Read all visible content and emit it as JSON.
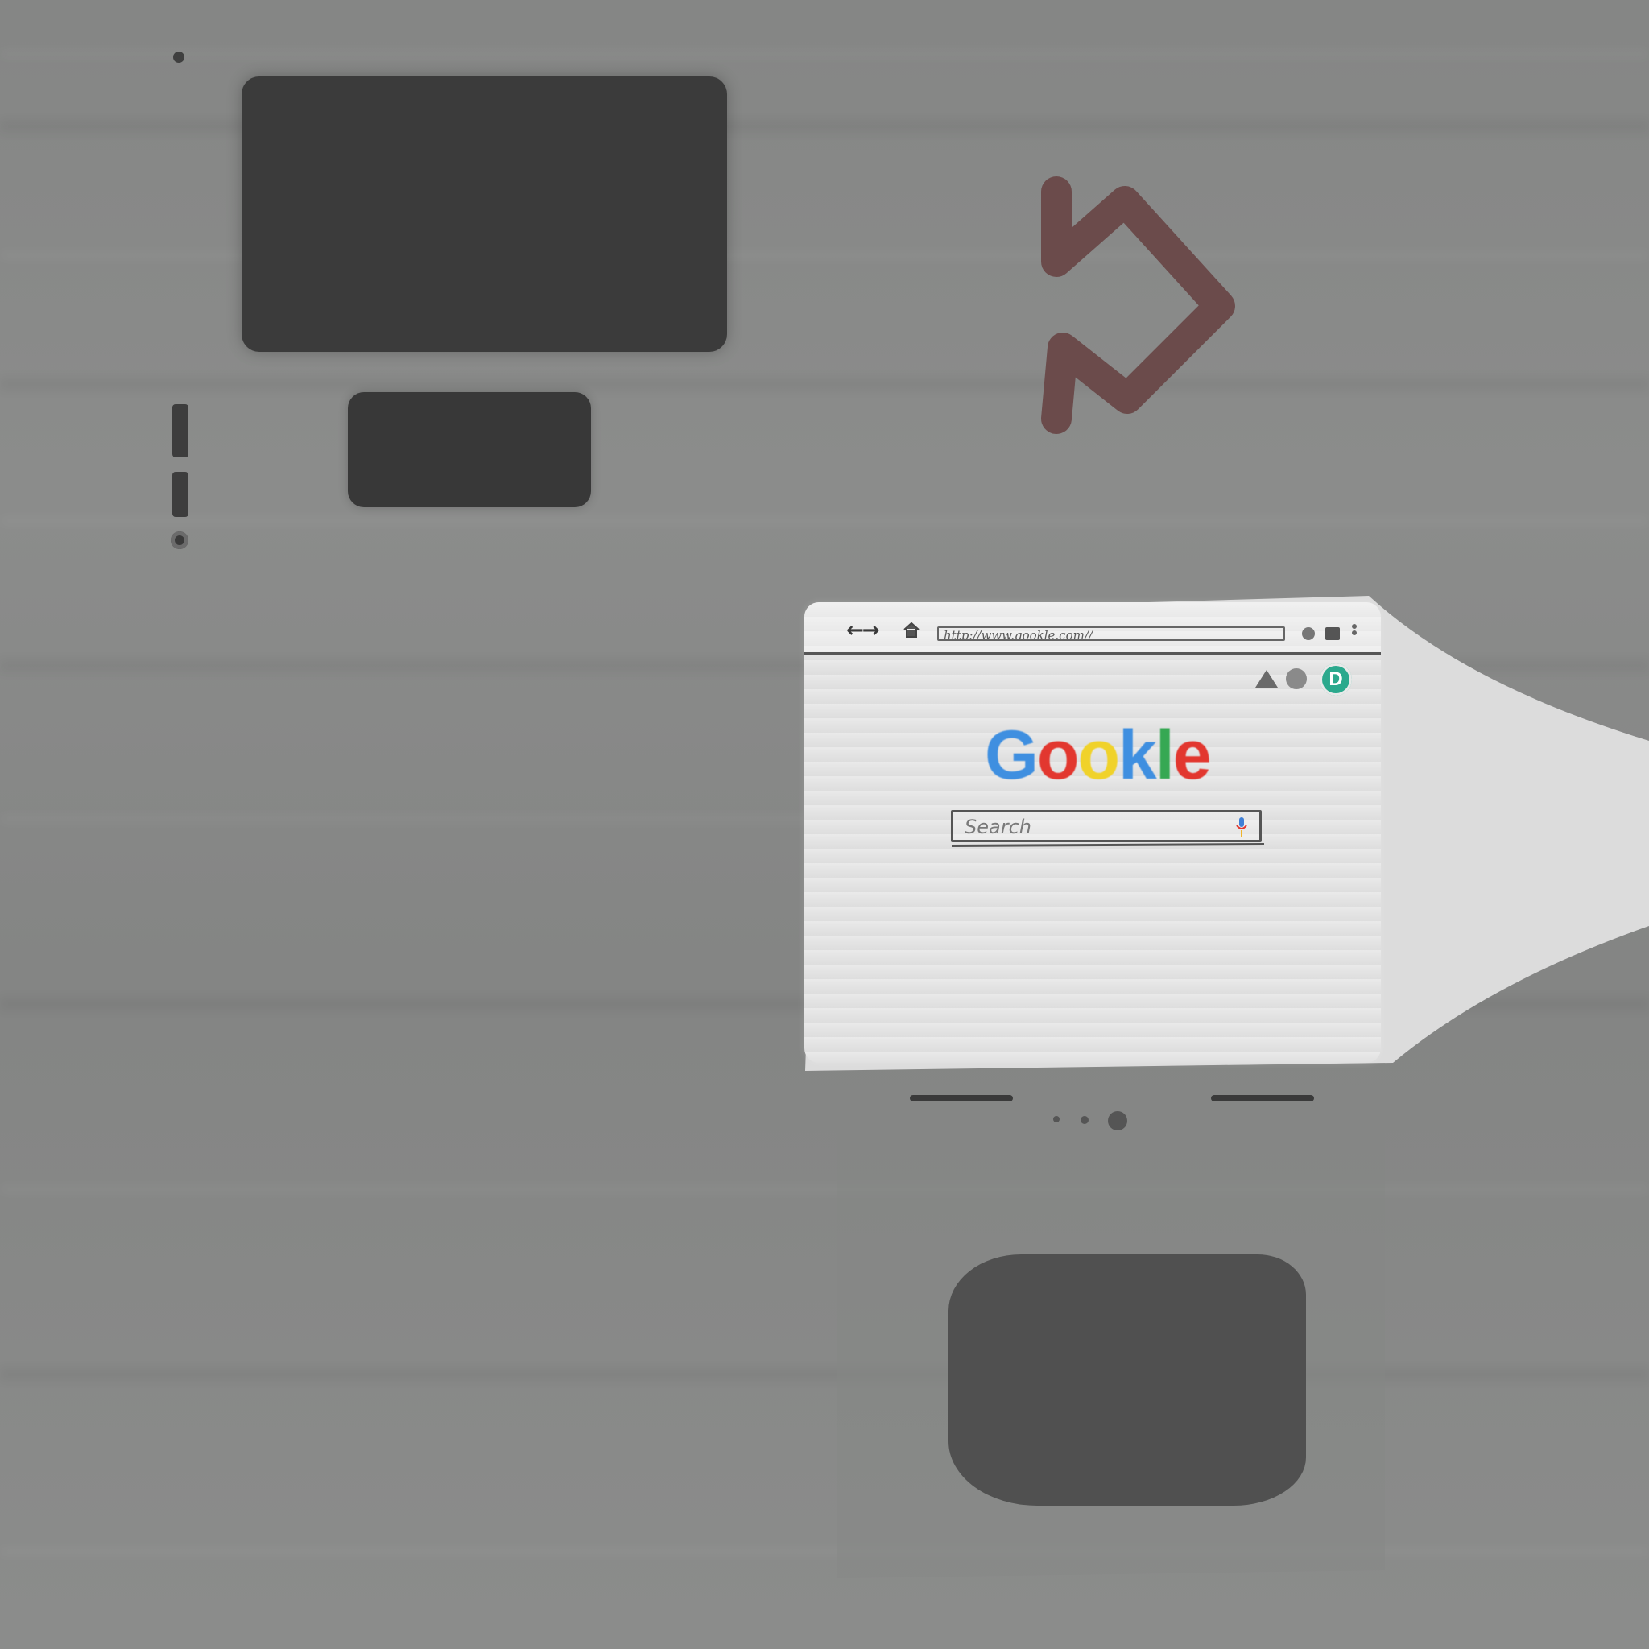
{
  "browser": {
    "url": "http://www.gookle.com//",
    "nav_symbol": "←→",
    "avatar_letter": "D",
    "logo_letters": [
      {
        "char": "G",
        "color": "#3f8fe0"
      },
      {
        "char": "o",
        "color": "#e2372f"
      },
      {
        "char": "o",
        "color": "#f0d22a"
      },
      {
        "char": "k",
        "color": "#3f8fe0"
      },
      {
        "char": "l",
        "color": "#36a853"
      },
      {
        "char": "e",
        "color": "#e2372f"
      }
    ],
    "search_placeholder": "Search",
    "icons": [
      "back-arrow-icon",
      "forward-arrow-icon",
      "home-icon",
      "warning-icon",
      "notification-icon",
      "avatar",
      "microphone-icon"
    ]
  },
  "rotate_icon": {
    "name": "rotate-icon",
    "color": "#6b4b4b"
  },
  "colors": {
    "background": "#898a89",
    "dark_panel": "#3b3b3b",
    "home_button": "#505050",
    "avatar_bg": "#2ba98d",
    "screen_bg": "#e3e3e3"
  }
}
